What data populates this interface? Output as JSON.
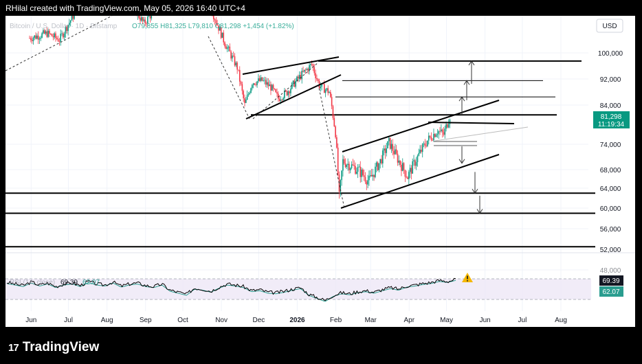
{
  "header": {
    "credit": "RHilal created with TradingView.com, May 05, 2026 16:40 UTC+4"
  },
  "legend": {
    "symbol": "Bitcoin / U.S. Dollar · 1D · Bitstamp",
    "ohlc": "O79,855  H81,325  L79,810  C81,298  +1,454 (+1.82%)",
    "currency": "USD"
  },
  "price_label": {
    "value": "81,298",
    "countdown": "11:19:34"
  },
  "rsi": {
    "label": "RSI (14, close)",
    "value": "69.39",
    "ma_value": "62.07",
    "value_badge": "69.39",
    "ma_badge": "62.07"
  },
  "brand": {
    "logo_mark": "17",
    "logo_text": "TradingView"
  },
  "colors": {
    "up": "#089981",
    "down": "#f23645",
    "rsi_line": "#000000",
    "rsi_ma": "#2a9d8f",
    "rsi_band": "#ede7f6"
  },
  "chart_data": {
    "type": "candlestick",
    "title": "Bitcoin / U.S. Dollar · 1D · Bitstamp",
    "y_ticks": [
      100000,
      92000,
      84000,
      74000,
      68000,
      64000,
      60000,
      56000,
      52000,
      48000
    ],
    "y_tick_labels": [
      "100,000",
      "92,000",
      "84,000",
      "74,000",
      "68,000",
      "64,000",
      "60,000",
      "56,000",
      "52,000",
      "48,000"
    ],
    "x_ticks": [
      "Jun",
      "Jul",
      "Aug",
      "Sep",
      "Oct",
      "Nov",
      "Dec",
      "2026",
      "Feb",
      "Mar",
      "Apr",
      "May",
      "Jun",
      "Jul",
      "Aug"
    ],
    "last_price": 81298,
    "price_path": [
      [
        "2025-06-01",
        104500
      ],
      [
        "2025-06-15",
        106000
      ],
      [
        "2025-06-25",
        104000
      ],
      [
        "2025-07-10",
        114000
      ],
      [
        "2025-07-20",
        118000
      ],
      [
        "2025-08-05",
        114500
      ],
      [
        "2025-08-15",
        119000
      ],
      [
        "2025-09-01",
        109000
      ],
      [
        "2025-09-15",
        116000
      ],
      [
        "2025-10-01",
        116500
      ],
      [
        "2025-10-06",
        124000
      ],
      [
        "2025-10-11",
        113000
      ],
      [
        "2025-10-25",
        113500
      ],
      [
        "2025-11-05",
        103000
      ],
      [
        "2025-11-15",
        95500
      ],
      [
        "2025-11-21",
        84000
      ],
      [
        "2025-11-27",
        91000
      ],
      [
        "2025-12-05",
        91500
      ],
      [
        "2025-12-12",
        89500
      ],
      [
        "2025-12-18",
        86000
      ],
      [
        "2025-12-25",
        88000
      ],
      [
        "2026-01-05",
        93000
      ],
      [
        "2026-01-14",
        96500
      ],
      [
        "2026-01-20",
        90000
      ],
      [
        "2026-01-28",
        88000
      ],
      [
        "2026-02-02",
        77000
      ],
      [
        "2026-02-05",
        62000
      ],
      [
        "2026-02-08",
        70000
      ],
      [
        "2026-02-20",
        68000
      ],
      [
        "2026-03-01",
        65500
      ],
      [
        "2026-03-10",
        70000
      ],
      [
        "2026-03-17",
        74500
      ],
      [
        "2026-03-25",
        70000
      ],
      [
        "2026-04-01",
        66500
      ],
      [
        "2026-04-10",
        71500
      ],
      [
        "2026-04-17",
        75000
      ],
      [
        "2026-04-25",
        77500
      ],
      [
        "2026-04-30",
        76500
      ],
      [
        "2026-05-05",
        81298
      ]
    ],
    "annotations": {
      "horizontal_levels": [
        97500,
        91500,
        86500,
        81500,
        63000,
        59000,
        52500
      ],
      "projection_arrows": [
        {
          "from": 90500,
          "to": 97500
        },
        {
          "from": 85500,
          "to": 91500
        },
        {
          "from": 81500,
          "to": 86500
        },
        {
          "from": 73500,
          "to": 69500
        },
        {
          "from": 67500,
          "to": 63000
        },
        {
          "from": 62500,
          "to": 59000
        }
      ]
    },
    "rsi": {
      "last": 69.39,
      "ma_last": 62.07,
      "band": [
        30,
        70
      ],
      "path": [
        63,
        60,
        57,
        64,
        58,
        62,
        55,
        60,
        62,
        57,
        65,
        60,
        58,
        64,
        56,
        60,
        62,
        57,
        55,
        60,
        48,
        44,
        40,
        52,
        50,
        46,
        54,
        60,
        58,
        55,
        47,
        49,
        44,
        43,
        46,
        50,
        53,
        40,
        34,
        28,
        38,
        43,
        41,
        45,
        47,
        44,
        49,
        53,
        50,
        56,
        58,
        61,
        63,
        67,
        65,
        69
      ]
    }
  }
}
